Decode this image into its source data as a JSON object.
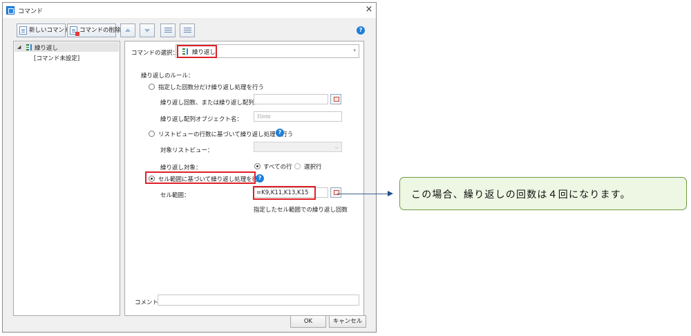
{
  "window": {
    "title": "コマンド",
    "close_glyph": "×"
  },
  "toolbar": {
    "new_command": "新しいコマンド",
    "delete_command": "コマンドの削除",
    "help_glyph": "?"
  },
  "tree": {
    "items": [
      {
        "label": "繰り返し",
        "expander": "◢"
      },
      {
        "label": "[コマンド未設定]"
      }
    ]
  },
  "settings": {
    "command_select_label": "コマンドの選択：",
    "command_selected": "繰り返し",
    "rule_heading": "繰り返しのルール：",
    "option_count_label": "指定した回数分だけ繰り返し処理を行う",
    "count_array_label": "繰り返し回数、または繰り返し配列：",
    "array_object_label": "繰り返し配列オブジェクト名：",
    "array_object_placeholder": "Item",
    "option_listview_label": "リストビューの行数に基づいて繰り返し処理を行う",
    "target_listview_label": "対象リストビュー：",
    "loop_target_label": "繰り返し対象：",
    "all_rows_label": "すべての行",
    "selected_rows_label": "選択行",
    "option_cell_label": "セル範囲に基づいて繰り返し処理を行う",
    "cell_range_label": "セル範囲：",
    "cell_range_value": "=K9,K11,K13,K15",
    "cell_range_note": "指定したセル範囲での繰り返し回数",
    "comment_label": "コメント",
    "comment_value": ""
  },
  "buttons": {
    "ok": "OK",
    "cancel": "キャンセル"
  },
  "annotation": {
    "text": "この場合、繰り返しの回数は４回になります。"
  },
  "colors": {
    "highlight": "#e01f26",
    "help": "#1e7fd8",
    "callout_fill": "#eef6e4",
    "callout_border": "#6f9b3d",
    "arrow": "#1e4e8c"
  },
  "icons": [
    "app-icon",
    "close-icon",
    "new-command-icon",
    "delete-command-icon",
    "move-up-icon",
    "move-down-icon",
    "indent-icon",
    "outdent-icon",
    "help-icon",
    "loop-icon",
    "range-select-icon",
    "chevron-down-icon",
    "arrow-icon"
  ]
}
